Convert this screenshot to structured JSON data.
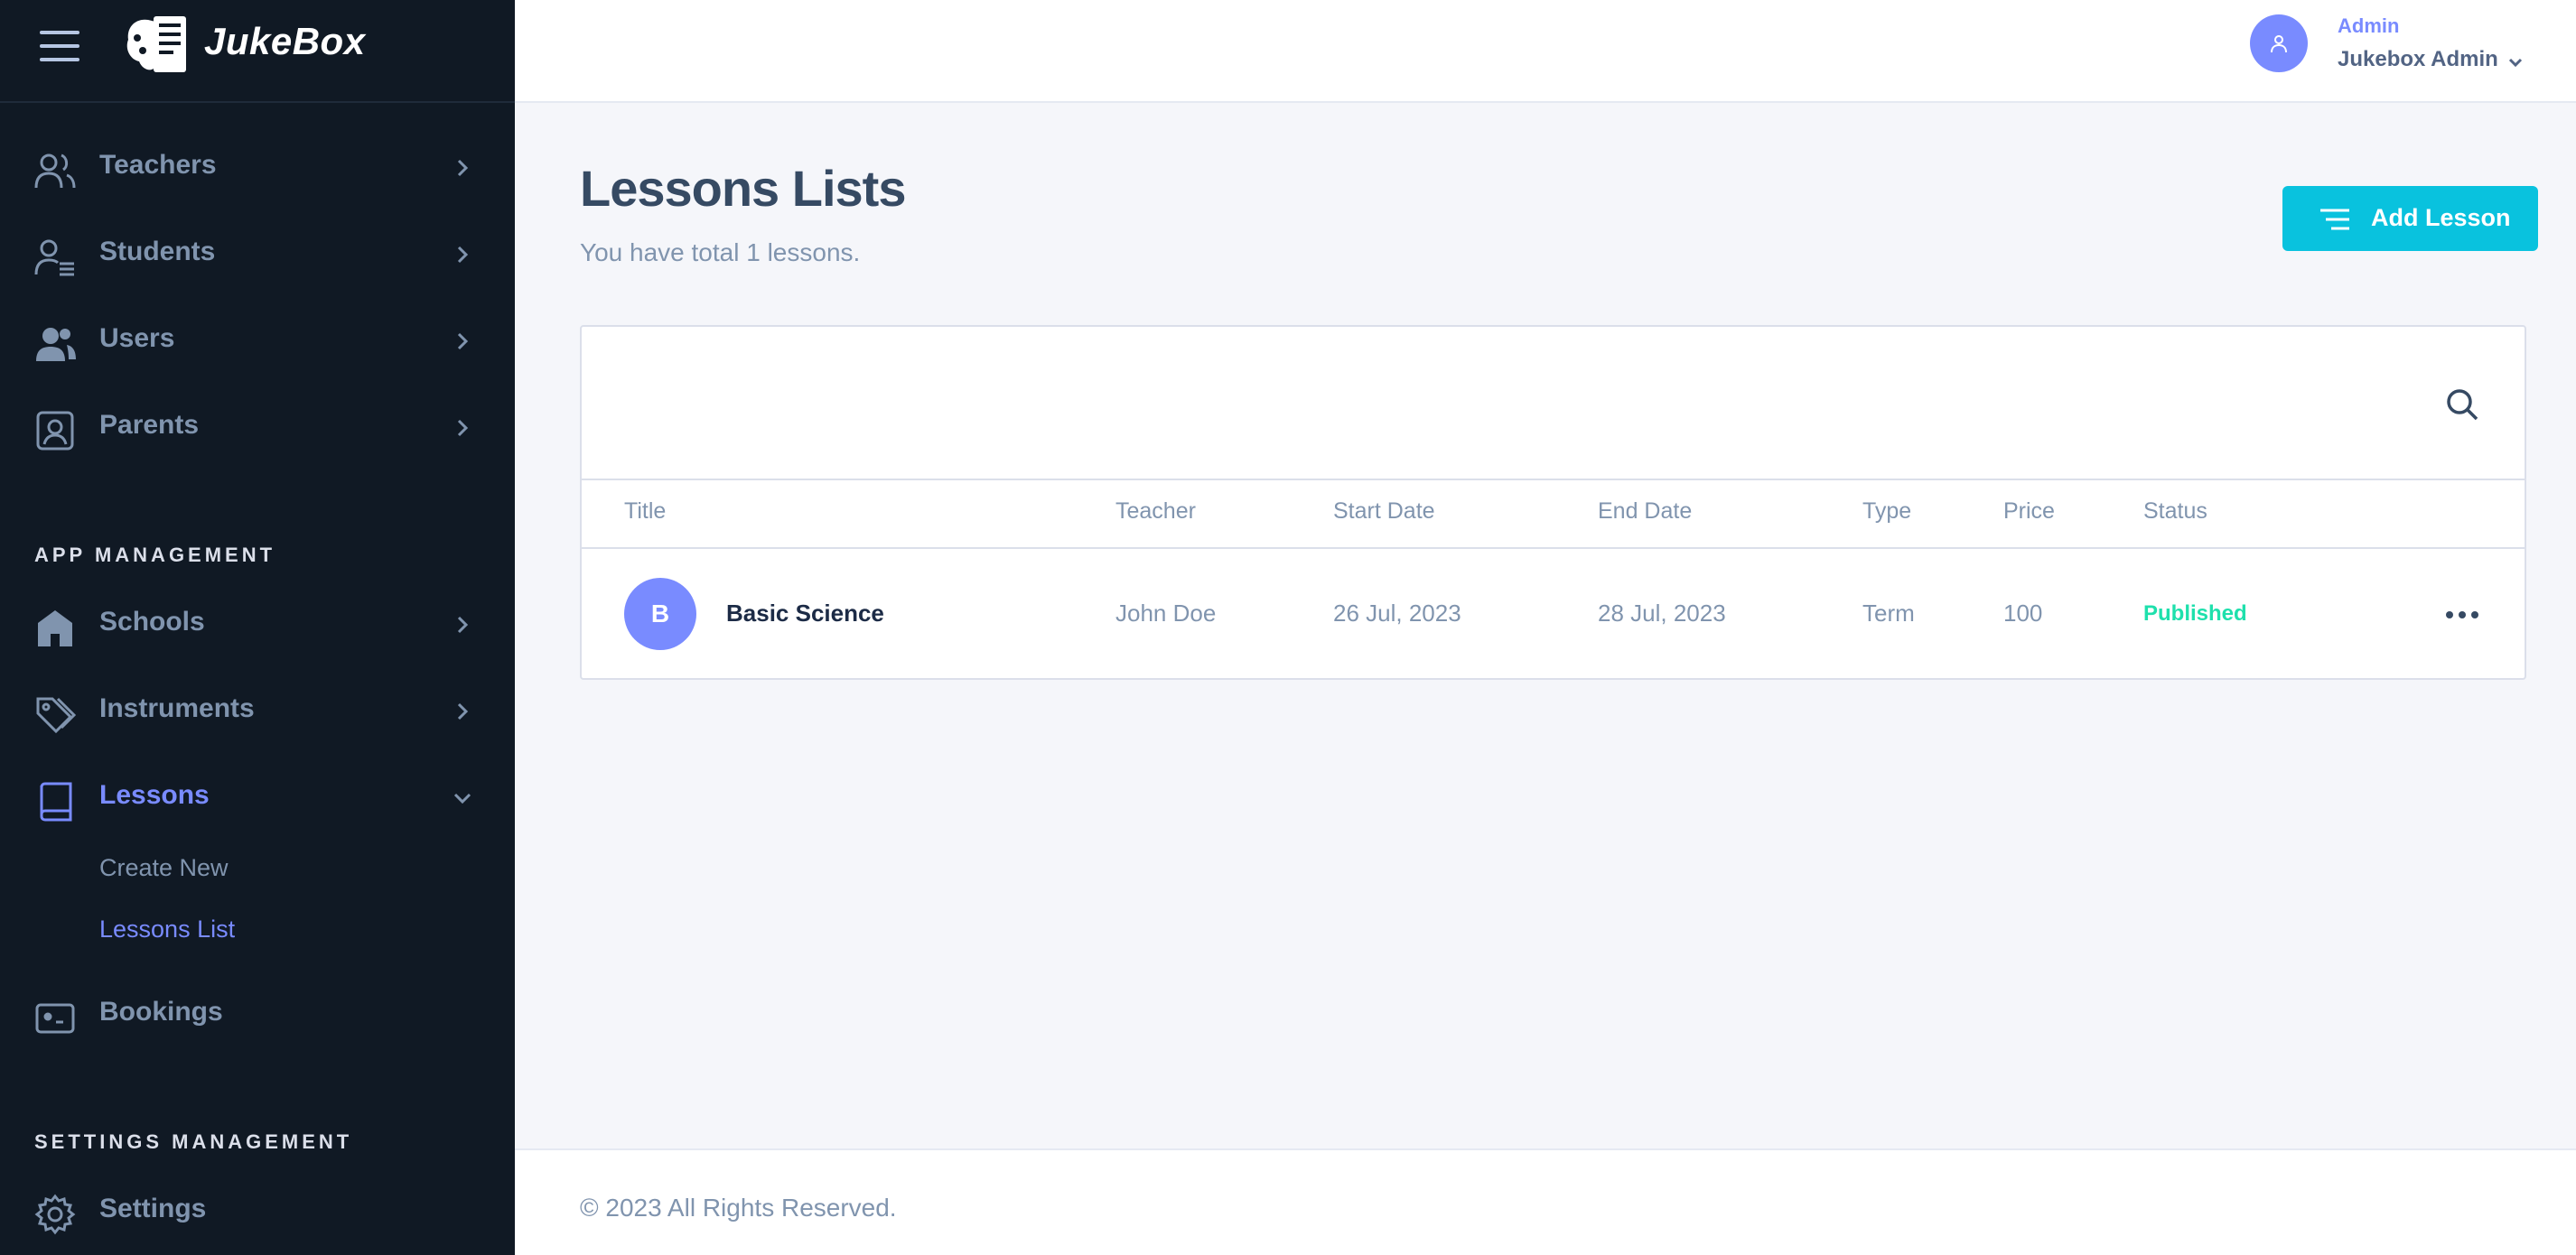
{
  "brand": {
    "name": "JukeBox"
  },
  "nav": {
    "items": [
      {
        "label": "Teachers",
        "icon": "teachers-icon"
      },
      {
        "label": "Students",
        "icon": "students-icon"
      },
      {
        "label": "Users",
        "icon": "users-icon"
      },
      {
        "label": "Parents",
        "icon": "parents-icon"
      }
    ],
    "app_section": "APP MANAGEMENT",
    "app_items": [
      {
        "label": "Schools",
        "icon": "school-icon"
      },
      {
        "label": "Instruments",
        "icon": "tag-icon"
      },
      {
        "label": "Lessons",
        "icon": "book-icon",
        "expanded": true
      }
    ],
    "lesson_sub": [
      {
        "label": "Create New"
      },
      {
        "label": "Lessons List",
        "active": true
      }
    ],
    "bookings": {
      "label": "Bookings",
      "icon": "ticket-icon"
    },
    "settings_section": "SETTINGS MANAGEMENT",
    "settings": {
      "label": "Settings",
      "icon": "gear-icon"
    }
  },
  "header": {
    "role": "Admin",
    "user_name": "Jukebox Admin"
  },
  "page": {
    "title": "Lessons Lists",
    "subtitle": "You have total 1 lessons.",
    "add_button": "Add Lesson"
  },
  "table": {
    "columns": [
      "Title",
      "Teacher",
      "Start Date",
      "End Date",
      "Type",
      "Price",
      "Status"
    ],
    "rows": [
      {
        "initial": "B",
        "title": "Basic Science",
        "teacher": "John Doe",
        "start": "26 Jul, 2023",
        "end": "28 Jul, 2023",
        "type": "Term",
        "price": "100",
        "status": "Published"
      }
    ]
  },
  "footer": {
    "text": "© 2023 All Rights Reserved."
  },
  "colors": {
    "sidebar": "#101924",
    "accent": "#798bff",
    "button": "#09c2de",
    "published": "#1ee0ac"
  }
}
